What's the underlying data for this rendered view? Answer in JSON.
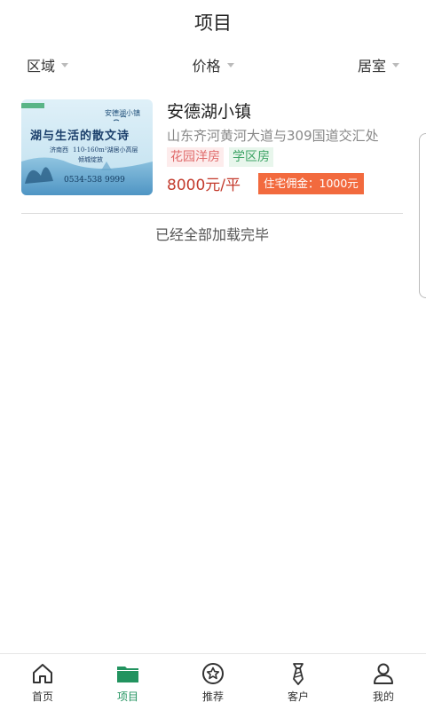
{
  "header": {
    "title": "项目"
  },
  "filters": [
    {
      "label": "区域"
    },
    {
      "label": "价格"
    },
    {
      "label": "居室"
    }
  ],
  "projects": [
    {
      "name": "安德湖小镇",
      "address": "山东齐河黄河大道与309国道交汇处",
      "tags": [
        "花园洋房",
        "学区房"
      ],
      "price": "8000元/平",
      "commission": "住宅佣金：1000元",
      "image": {
        "brand": "安德湖小镇",
        "slogan": "湖与生活的散文诗",
        "location": "济南西",
        "area_text": "110-160m²湖居小高层",
        "extra": "倾城绽放",
        "phone": "0534-538 9999"
      }
    }
  ],
  "list_end_text": "已经全部加载完毕",
  "tabbar": [
    {
      "label": "首页",
      "icon": "home-icon"
    },
    {
      "label": "项目",
      "icon": "folder-icon",
      "active": true
    },
    {
      "label": "推荐",
      "icon": "star-icon"
    },
    {
      "label": "客户",
      "icon": "tie-icon"
    },
    {
      "label": "我的",
      "icon": "user-icon"
    }
  ],
  "colors": {
    "accent": "#22935f",
    "price": "#c33a2c",
    "commission_bg": "#f26a3e"
  }
}
